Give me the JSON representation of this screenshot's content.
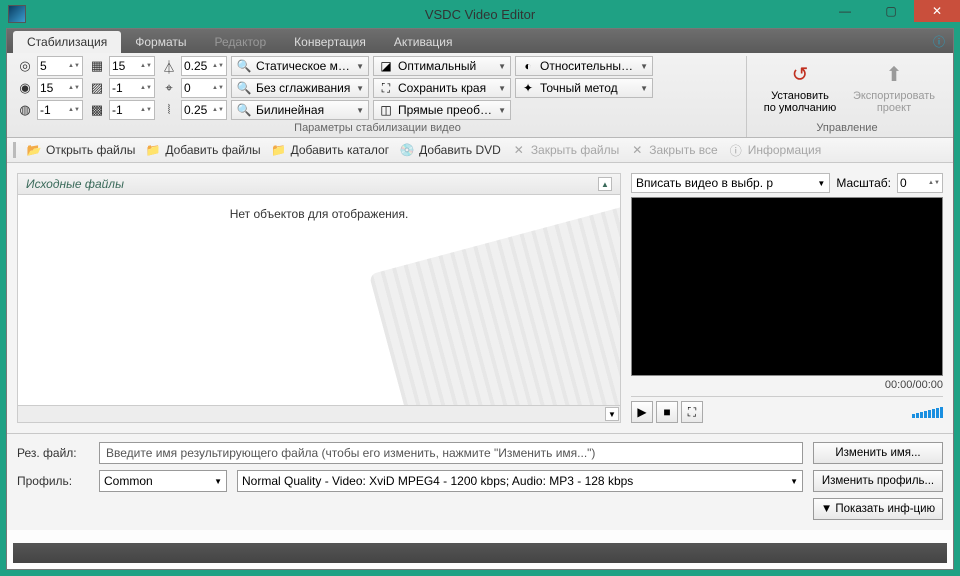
{
  "app": {
    "title": "VSDC Video Editor"
  },
  "tabs": [
    "Стабилизация",
    "Форматы",
    "Редактор",
    "Конвертация",
    "Активация"
  ],
  "active_tab": 0,
  "ribbon": {
    "col1": [
      {
        "icon": "◎",
        "val": "5"
      },
      {
        "icon": "◉",
        "val": "15"
      },
      {
        "icon": "◍",
        "val": "-1"
      }
    ],
    "col2": [
      {
        "icon": "▦",
        "val": "15"
      },
      {
        "icon": "▨",
        "val": "-1"
      },
      {
        "icon": "▩",
        "val": "-1"
      }
    ],
    "col3": [
      {
        "icon": "⏃",
        "val": "0.25"
      },
      {
        "icon": "⌖",
        "val": "0"
      },
      {
        "icon": "⦚",
        "val": "0.25"
      }
    ],
    "dd1": [
      {
        "icon": "🔍",
        "label": "Статическое масшт"
      },
      {
        "icon": "🔍",
        "label": "Без сглаживания"
      },
      {
        "icon": "🔍",
        "label": "Билинейная"
      }
    ],
    "dd2": [
      {
        "icon": "◪",
        "label": "Оптимальный"
      },
      {
        "icon": "⛶",
        "label": "Сохранить края"
      },
      {
        "icon": "◫",
        "label": "Прямые преобраз"
      }
    ],
    "dd3": [
      {
        "icon": "◐",
        "label": "Относительные пр"
      },
      {
        "icon": "✦",
        "label": "Точный метод"
      }
    ],
    "group1_label": "Параметры стабилизации видео",
    "group2_label": "Управление",
    "reset": "Установить\nпо умолчанию",
    "export": "Экспортировать\nпроект"
  },
  "toolbar": {
    "open": "Открыть файлы",
    "add": "Добавить файлы",
    "addcat": "Добавить каталог",
    "adddvd": "Добавить DVD",
    "close": "Закрыть файлы",
    "closeall": "Закрыть все",
    "info": "Информация"
  },
  "source": {
    "header": "Исходные файлы",
    "empty": "Нет объектов для отображения."
  },
  "preview": {
    "fit": "Вписать видео в выбр. р",
    "zoom_label": "Масштаб:",
    "zoom_val": "0",
    "timecode": "00:00/00:00"
  },
  "bottom": {
    "resfile_label": "Рез. файл:",
    "resfile_placeholder": "Введите имя результирующего файла (чтобы его изменить, нажмите \"Изменить имя...\")",
    "profile_label": "Профиль:",
    "profile_sel": "Common",
    "profile_desc": "Normal Quality - Video: XviD MPEG4 - 1200 kbps; Audio: MP3 - 128 kbps",
    "change_name": "Изменить имя...",
    "change_profile": "Изменить профиль...",
    "show_info": "▼ Показать инф-цию"
  }
}
